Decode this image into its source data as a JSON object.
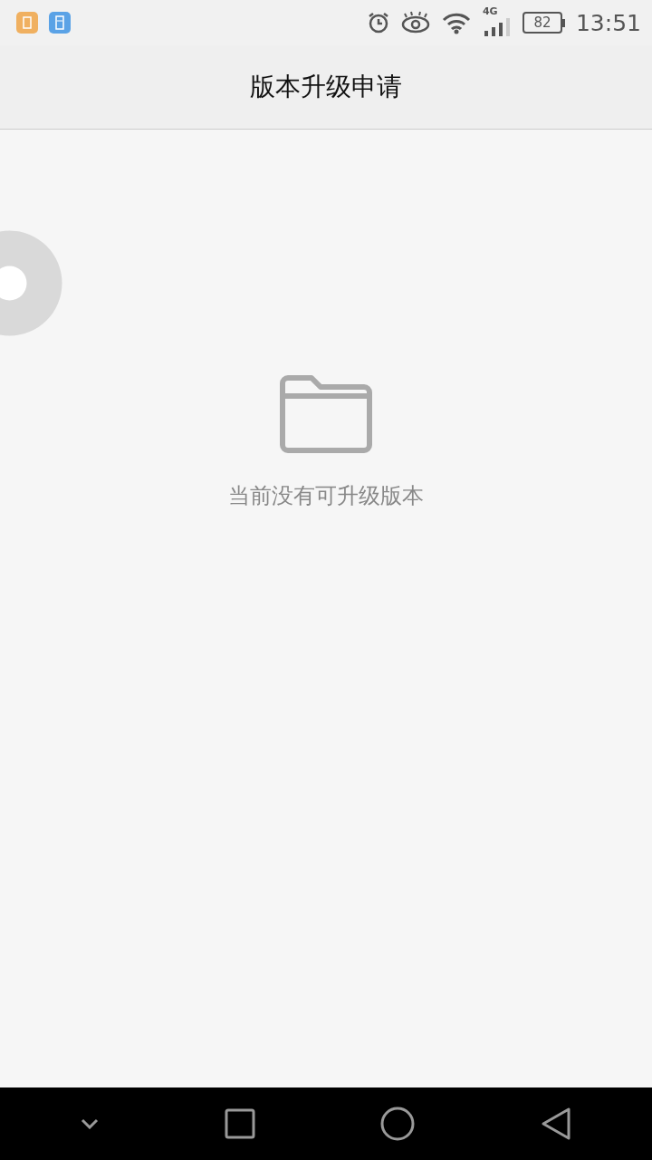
{
  "status_bar": {
    "network": "4G",
    "battery": "82",
    "time": "13:51"
  },
  "header": {
    "title": "版本升级申请"
  },
  "empty_state": {
    "message": "当前没有可升级版本"
  }
}
